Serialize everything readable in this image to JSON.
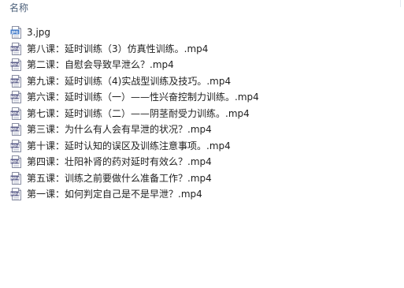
{
  "header": {
    "name_column_label": "名称"
  },
  "files": [
    {
      "name": "3.jpg",
      "icon": "jpg-file-icon"
    },
    {
      "name": "第八课：延时训练（3）仿真性训练。.mp4",
      "icon": "mp4-file-icon"
    },
    {
      "name": "第二课：自慰会导致早泄么？.mp4",
      "icon": "mp4-file-icon"
    },
    {
      "name": "第九课：延时训练（4)实战型训练及技巧。.mp4",
      "icon": "mp4-file-icon"
    },
    {
      "name": "第六课：延时训练（一）——性兴奋控制力训练。.mp4",
      "icon": "mp4-file-icon"
    },
    {
      "name": "第七课：延时训练（二）——阴茎耐受力训练。.mp4",
      "icon": "mp4-file-icon"
    },
    {
      "name": "第三课：为什么有人会有早泄的状况？.mp4",
      "icon": "mp4-file-icon"
    },
    {
      "name": "第十课：延时认知的误区及训练注意事项。.mp4",
      "icon": "mp4-file-icon"
    },
    {
      "name": "第四课：壮阳补肾的药对延时有效么？.mp4",
      "icon": "mp4-file-icon"
    },
    {
      "name": "第五课：训练之前要做什么准备工作？.mp4",
      "icon": "mp4-file-icon"
    },
    {
      "name": "第一课：如何判定自己是不是早泄？.mp4",
      "icon": "mp4-file-icon"
    }
  ],
  "icon_labels": {
    "jpg": "JPG",
    "mp4": "MP4"
  },
  "colors": {
    "header_text": "#4c607a",
    "file_text": "#1e1e1e",
    "mp4_icon_band": "#5b5e8a",
    "jpg_icon_band": "#3f78c8"
  }
}
